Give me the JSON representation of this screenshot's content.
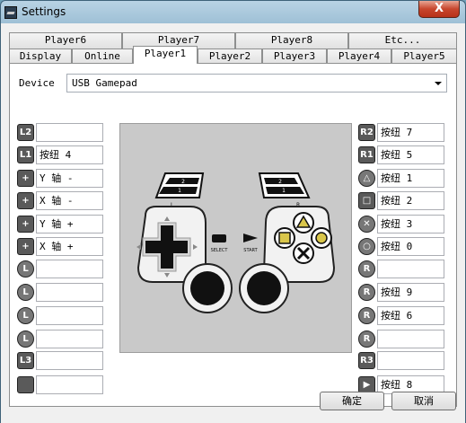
{
  "window": {
    "title": "Settings",
    "close_glyph": "X"
  },
  "tabs": {
    "back": [
      "Player6",
      "Player7",
      "Player8",
      "Etc..."
    ],
    "front": [
      "Display",
      "Online",
      "Player1",
      "Player2",
      "Player3",
      "Player4",
      "Player5"
    ],
    "selected": "Player1"
  },
  "device": {
    "label": "Device",
    "value": "USB Gamepad"
  },
  "left_mappings": [
    {
      "icon": "l2-button-icon",
      "glyph": "L2",
      "value": ""
    },
    {
      "icon": "l1-button-icon",
      "glyph": "L1",
      "value": "按纽 4"
    },
    {
      "icon": "dpad-up-icon",
      "glyph": "+",
      "value": "Y 轴 -"
    },
    {
      "icon": "dpad-left-icon",
      "glyph": "+",
      "value": "X 轴 -"
    },
    {
      "icon": "dpad-down-icon",
      "glyph": "+",
      "value": "Y 轴 +"
    },
    {
      "icon": "dpad-right-icon",
      "glyph": "+",
      "value": "X 轴 +"
    },
    {
      "icon": "left-stick-up-icon",
      "glyph": "L",
      "value": ""
    },
    {
      "icon": "left-stick-left-icon",
      "glyph": "L",
      "value": ""
    },
    {
      "icon": "left-stick-down-icon",
      "glyph": "L",
      "value": ""
    },
    {
      "icon": "left-stick-right-icon",
      "glyph": "L",
      "value": ""
    },
    {
      "icon": "l3-button-icon",
      "glyph": "L3",
      "value": ""
    },
    {
      "icon": "select-button-icon",
      "glyph": "",
      "value": ""
    }
  ],
  "right_mappings": [
    {
      "icon": "r2-button-icon",
      "glyph": "R2",
      "value": "按纽 7"
    },
    {
      "icon": "r1-button-icon",
      "glyph": "R1",
      "value": "按纽 5"
    },
    {
      "icon": "triangle-button-icon",
      "glyph": "△",
      "value": "按纽 1"
    },
    {
      "icon": "square-button-icon",
      "glyph": "□",
      "value": "按纽 2"
    },
    {
      "icon": "cross-button-icon",
      "glyph": "✕",
      "value": "按纽 3"
    },
    {
      "icon": "circle-button-icon",
      "glyph": "○",
      "value": "按纽 0"
    },
    {
      "icon": "right-stick-up-icon",
      "glyph": "R",
      "value": ""
    },
    {
      "icon": "right-stick-left-icon",
      "glyph": "R",
      "value": "按纽 9"
    },
    {
      "icon": "right-stick-down-icon",
      "glyph": "R",
      "value": "按纽 6"
    },
    {
      "icon": "right-stick-right-icon",
      "glyph": "R",
      "value": ""
    },
    {
      "icon": "r3-button-icon",
      "glyph": "R3",
      "value": ""
    },
    {
      "icon": "start-button-icon",
      "glyph": "▶",
      "value": "按纽 8"
    }
  ],
  "controller": {
    "left_grip_labels": [
      "2",
      "1"
    ],
    "right_grip_labels": [
      "2",
      "1"
    ],
    "left_side_label": "L",
    "right_side_label": "R",
    "select_label": "SELECT",
    "start_label": "START"
  },
  "buttons": {
    "ok": "确定",
    "cancel": "取消"
  }
}
